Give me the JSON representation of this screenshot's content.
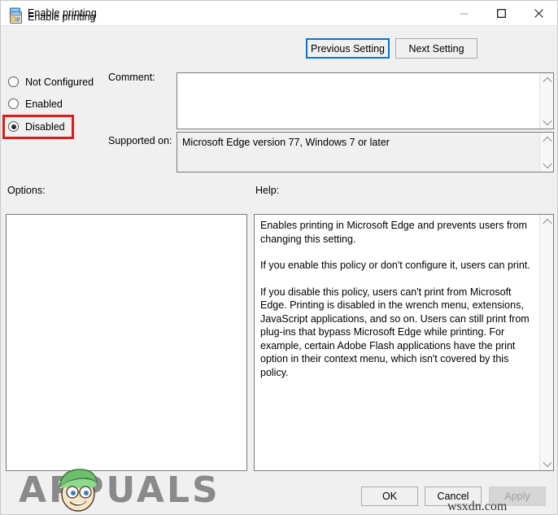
{
  "window": {
    "title": "Enable printing",
    "icon": "policy-setting-icon",
    "minimize_label": "Minimize",
    "maximize_label": "Maximize",
    "close_label": "Close"
  },
  "header": {
    "title": "Enable printing",
    "icon": "policy-document-icon",
    "previous_setting": "Previous Setting",
    "next_setting": "Next Setting"
  },
  "state": {
    "options": [
      {
        "label": "Not Configured",
        "checked": false
      },
      {
        "label": "Enabled",
        "checked": false
      },
      {
        "label": "Disabled",
        "checked": true
      }
    ],
    "highlighted_option": "Disabled",
    "highlight_color": "#e01b1b"
  },
  "fields": {
    "comment_label": "Comment:",
    "comment_value": "",
    "supported_label": "Supported on:",
    "supported_value": "Microsoft Edge version 77, Windows 7 or later"
  },
  "panels": {
    "options_label": "Options:",
    "options_content": "",
    "help_label": "Help:",
    "help_paragraphs": [
      "Enables printing in Microsoft Edge and prevents users from changing this setting.",
      "If you enable this policy or don't configure it, users can print.",
      "If you disable this policy, users can't print from Microsoft Edge. Printing is disabled in the wrench menu, extensions, JavaScript applications, and so on. Users can still print from plug-ins that bypass Microsoft Edge while printing. For example, certain Adobe Flash applications have the print option in their context menu, which isn't covered by this policy."
    ]
  },
  "footer": {
    "ok": "OK",
    "cancel": "Cancel",
    "apply": "Apply",
    "apply_enabled": false
  },
  "watermarks": {
    "brand": "APPUALS",
    "site": "wsxdn.com"
  },
  "colors": {
    "accent": "#0078d7",
    "annotation": "#e01b1b",
    "dialog_bg": "#f0f0f0",
    "field_bg": "#ffffff",
    "readonly_bg": "#f0f0f0"
  }
}
